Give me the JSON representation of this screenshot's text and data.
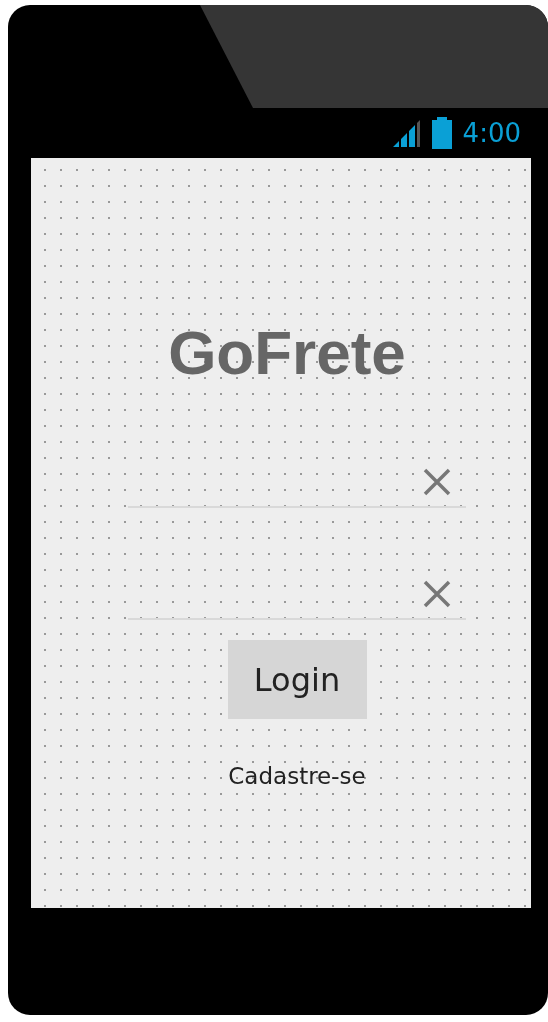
{
  "status_bar": {
    "time": "4:00"
  },
  "app": {
    "title": "GoFrete",
    "fields": [
      {
        "kind": "clearable"
      },
      {
        "kind": "clearable"
      }
    ],
    "login_button": "Login",
    "signup_link": "Cadastre-se"
  }
}
